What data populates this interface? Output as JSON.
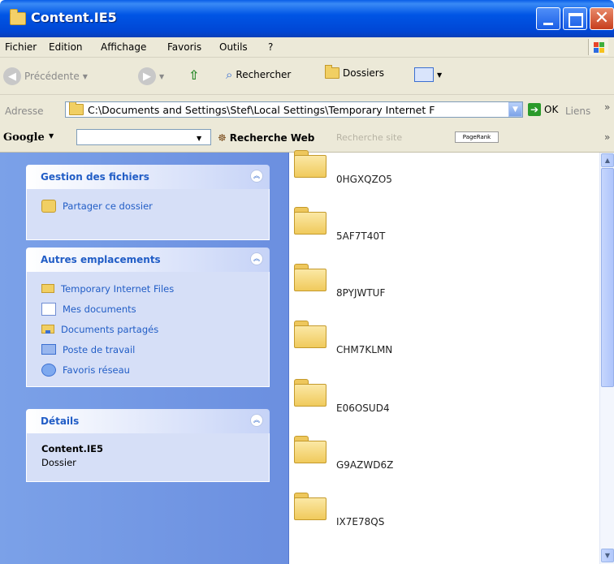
{
  "window": {
    "title": "Content.IE5",
    "close_glyph": "✕"
  },
  "menu": [
    "Fichier",
    "Edition",
    "Affichage",
    "Favoris",
    "Outils",
    "?"
  ],
  "toolbar": {
    "back_label": "Précédente",
    "search_label": "Rechercher",
    "folders_label": "Dossiers"
  },
  "address": {
    "label": "Adresse",
    "path": "C:\\Documents and Settings\\Stef\\Local Settings\\Temporary Internet F",
    "go_label": "OK",
    "links_label": "Liens"
  },
  "google": {
    "logo": "Google",
    "web_search_label": "Recherche Web",
    "site_search_label": "Recherche site",
    "pagerank_label": "PageRank"
  },
  "sidebar": {
    "file_tasks": {
      "title": "Gestion des fichiers",
      "items": [
        {
          "label": "Partager ce dossier",
          "icon": "share-hand-icon"
        }
      ]
    },
    "other_places": {
      "title": "Autres emplacements",
      "items": [
        {
          "label": "Temporary Internet Files",
          "icon": "folder-icon"
        },
        {
          "label": "Mes documents",
          "icon": "documents-icon"
        },
        {
          "label": "Documents partagés",
          "icon": "shared-folder-icon"
        },
        {
          "label": "Poste de travail",
          "icon": "computer-icon"
        },
        {
          "label": "Favoris réseau",
          "icon": "network-icon"
        }
      ]
    },
    "details": {
      "title": "Détails",
      "name": "Content.IE5",
      "type": "Dossier"
    }
  },
  "files": [
    {
      "name": "0HGXQZO5"
    },
    {
      "name": "5AF7T40T"
    },
    {
      "name": "8PYJWTUF"
    },
    {
      "name": "CHM7KLMN"
    },
    {
      "name": "E06OSUD4"
    },
    {
      "name": "G9AZWD6Z"
    },
    {
      "name": "IX7E78QS"
    }
  ]
}
